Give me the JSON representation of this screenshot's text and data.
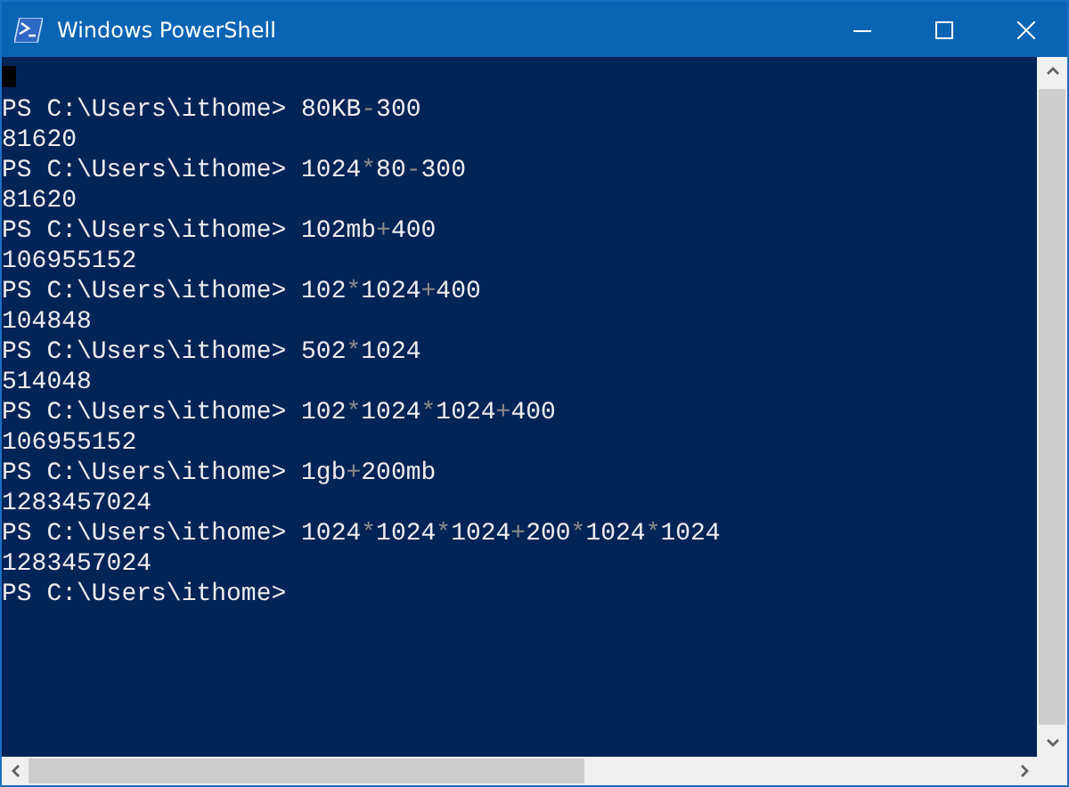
{
  "window": {
    "title": "Windows PowerShell"
  },
  "console": {
    "cursor": true,
    "lines": [
      {
        "kind": "command",
        "prompt": "PS C:\\Users\\ithome>",
        "segments": [
          {
            "kind": "value",
            "text": "80KB"
          },
          {
            "kind": "operator",
            "text": "-"
          },
          {
            "kind": "value",
            "text": "300"
          }
        ]
      },
      {
        "kind": "output",
        "text": "81620"
      },
      {
        "kind": "command",
        "prompt": "PS C:\\Users\\ithome>",
        "segments": [
          {
            "kind": "value",
            "text": "1024"
          },
          {
            "kind": "operator",
            "text": "*"
          },
          {
            "kind": "value",
            "text": "80"
          },
          {
            "kind": "operator",
            "text": "-"
          },
          {
            "kind": "value",
            "text": "300"
          }
        ]
      },
      {
        "kind": "output",
        "text": "81620"
      },
      {
        "kind": "command",
        "prompt": "PS C:\\Users\\ithome>",
        "segments": [
          {
            "kind": "value",
            "text": "102mb"
          },
          {
            "kind": "operator",
            "text": "+"
          },
          {
            "kind": "value",
            "text": "400"
          }
        ]
      },
      {
        "kind": "output",
        "text": "106955152"
      },
      {
        "kind": "command",
        "prompt": "PS C:\\Users\\ithome>",
        "segments": [
          {
            "kind": "value",
            "text": "102"
          },
          {
            "kind": "operator",
            "text": "*"
          },
          {
            "kind": "value",
            "text": "1024"
          },
          {
            "kind": "operator",
            "text": "+"
          },
          {
            "kind": "value",
            "text": "400"
          }
        ]
      },
      {
        "kind": "output",
        "text": "104848"
      },
      {
        "kind": "command",
        "prompt": "PS C:\\Users\\ithome>",
        "segments": [
          {
            "kind": "value",
            "text": "502"
          },
          {
            "kind": "operator",
            "text": "*"
          },
          {
            "kind": "value",
            "text": "1024"
          }
        ]
      },
      {
        "kind": "output",
        "text": "514048"
      },
      {
        "kind": "command",
        "prompt": "PS C:\\Users\\ithome>",
        "segments": [
          {
            "kind": "value",
            "text": "102"
          },
          {
            "kind": "operator",
            "text": "*"
          },
          {
            "kind": "value",
            "text": "1024"
          },
          {
            "kind": "operator",
            "text": "*"
          },
          {
            "kind": "value",
            "text": "1024"
          },
          {
            "kind": "operator",
            "text": "+"
          },
          {
            "kind": "value",
            "text": "400"
          }
        ]
      },
      {
        "kind": "output",
        "text": "106955152"
      },
      {
        "kind": "command",
        "prompt": "PS C:\\Users\\ithome>",
        "segments": [
          {
            "kind": "value",
            "text": "1gb"
          },
          {
            "kind": "operator",
            "text": "+"
          },
          {
            "kind": "value",
            "text": "200mb"
          }
        ]
      },
      {
        "kind": "output",
        "text": "1283457024"
      },
      {
        "kind": "command",
        "prompt": "PS C:\\Users\\ithome>",
        "segments": [
          {
            "kind": "value",
            "text": "1024"
          },
          {
            "kind": "operator",
            "text": "*"
          },
          {
            "kind": "value",
            "text": "1024"
          },
          {
            "kind": "operator",
            "text": "*"
          },
          {
            "kind": "value",
            "text": "1024"
          },
          {
            "kind": "operator",
            "text": "+"
          },
          {
            "kind": "value",
            "text": "200"
          },
          {
            "kind": "operator",
            "text": "*"
          },
          {
            "kind": "value",
            "text": "1024"
          },
          {
            "kind": "operator",
            "text": "*"
          },
          {
            "kind": "value",
            "text": "1024"
          }
        ]
      },
      {
        "kind": "output",
        "text": "1283457024"
      },
      {
        "kind": "command",
        "prompt": "PS C:\\Users\\ithome>"
      }
    ]
  }
}
